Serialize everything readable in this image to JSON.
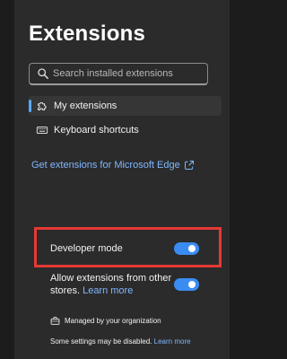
{
  "page": {
    "title": "Extensions"
  },
  "search": {
    "placeholder": "Search installed extensions"
  },
  "navigation": [
    {
      "label": "My extensions",
      "icon": "puzzle-icon",
      "selected": true
    },
    {
      "label": "Keyboard shortcuts",
      "icon": "keyboard-icon",
      "selected": false
    }
  ],
  "store": {
    "link_label": "Get extensions for Microsoft Edge",
    "icon": "external-link-icon"
  },
  "settings": {
    "developer_mode": {
      "label": "Developer mode",
      "enabled": true
    },
    "allow_other_stores": {
      "label_before": "Allow extensions from other stores.",
      "learn_more": "Learn more",
      "enabled": true
    }
  },
  "managed": {
    "label": "Managed by your organization",
    "icon": "briefcase-icon",
    "note_before": "Some settings may be disabled.",
    "learn_more": "Learn more"
  },
  "colors": {
    "page_background": "#1c1c1c",
    "panel_background": "#2b2b2b",
    "accent": "#3a8cf3",
    "link": "#7fb7ff",
    "highlight": "#e53935"
  }
}
